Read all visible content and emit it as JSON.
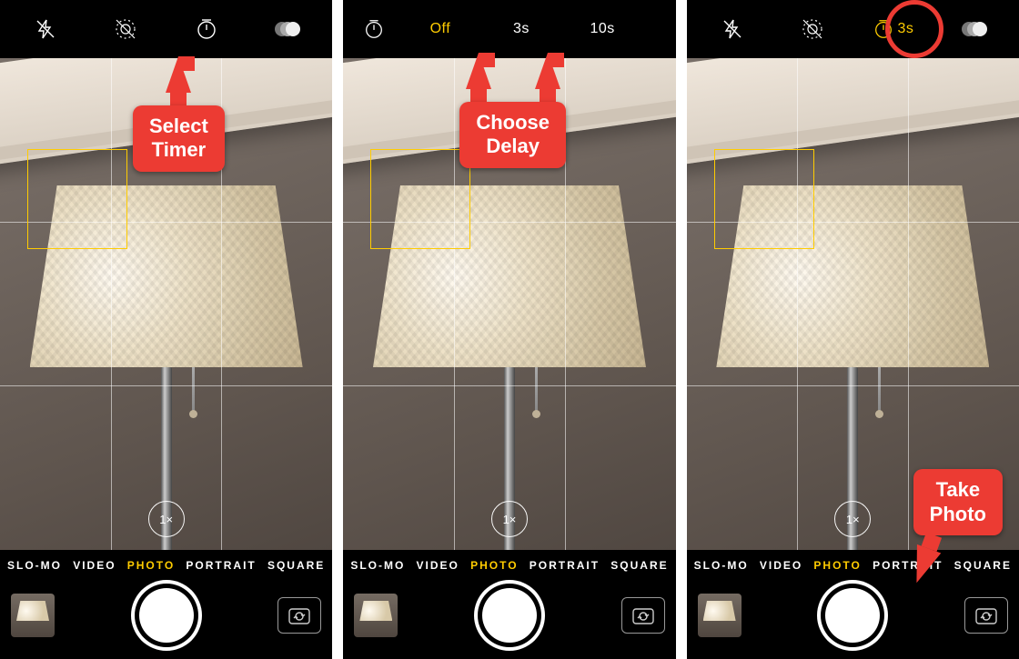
{
  "screens": {
    "modes": [
      "SLO-MO",
      "VIDEO",
      "PHOTO",
      "PORTRAIT",
      "SQUARE"
    ],
    "active_mode_index": 2,
    "zoom": "1×"
  },
  "screen1": {
    "topbar": {
      "flash": "flash-off-icon",
      "live": "live-photo-off-icon",
      "timer": "timer-icon",
      "filters": "filters-icon"
    },
    "callout": "Select\nTimer"
  },
  "screen2": {
    "topbar_timer_icon": "timer-icon",
    "options": {
      "off": "Off",
      "three": "3s",
      "ten": "10s"
    },
    "callout": "Choose\nDelay"
  },
  "screen3": {
    "topbar": {
      "flash": "flash-off-icon",
      "live": "live-photo-off-icon",
      "timer_label": "3s",
      "filters": "filters-icon"
    },
    "callout": "Take\nPhoto"
  }
}
